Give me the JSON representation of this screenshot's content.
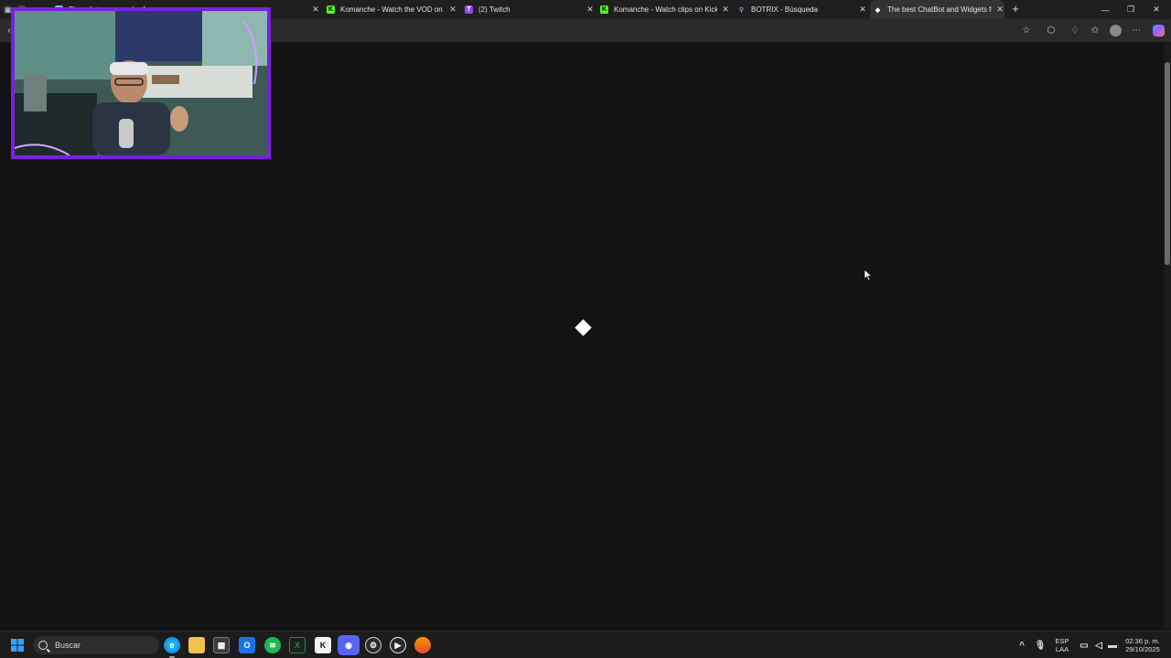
{
  "browser": {
    "tabs": [
      {
        "title": "El analista con mucho Ayres...",
        "icon": "generic-tab-icon",
        "favicon_color": "#9ea3ff",
        "active": false
      },
      {
        "title": "Komanche - Watch the VOD on Kick",
        "icon": "kick-icon",
        "favicon_color": "#53fc18",
        "active": false
      },
      {
        "title": "(2) Twitch",
        "icon": "twitch-icon",
        "favicon_color": "#9146ff",
        "active": false
      },
      {
        "title": "Komanche - Watch clips on Kick",
        "icon": "kick-icon",
        "favicon_color": "#53fc18",
        "active": false
      },
      {
        "title": "BOTRIX - Búsqueda",
        "icon": "search-icon",
        "favicon_color": "#6ea8ff",
        "active": false
      },
      {
        "title": "The best ChatBot and Widgets for",
        "icon": "botrix-icon",
        "favicon_color": "#ffffff",
        "active": true
      }
    ],
    "new_tab_label": "+",
    "window_controls": {
      "minimize": "—",
      "restore": "❐",
      "close": "✕"
    }
  },
  "page": {
    "loading_indicator": "diamond-spinner"
  },
  "taskbar": {
    "search_placeholder": "Buscar",
    "language": "ESP",
    "keyboard": "LAA",
    "time": "02:36 p. m.",
    "date": "29/10/2025",
    "apps": [
      "edge-icon",
      "file-explorer-icon",
      "store-icon",
      "outlook-icon",
      "spotify-icon",
      "excel-icon",
      "capcut-icon",
      "discord-icon",
      "steam-icon",
      "media-player-icon",
      "firefox-icon"
    ]
  },
  "colors": {
    "accent": "#7b1fe0",
    "background": "#131313",
    "kick": "#53fc18",
    "twitch": "#9146ff"
  }
}
